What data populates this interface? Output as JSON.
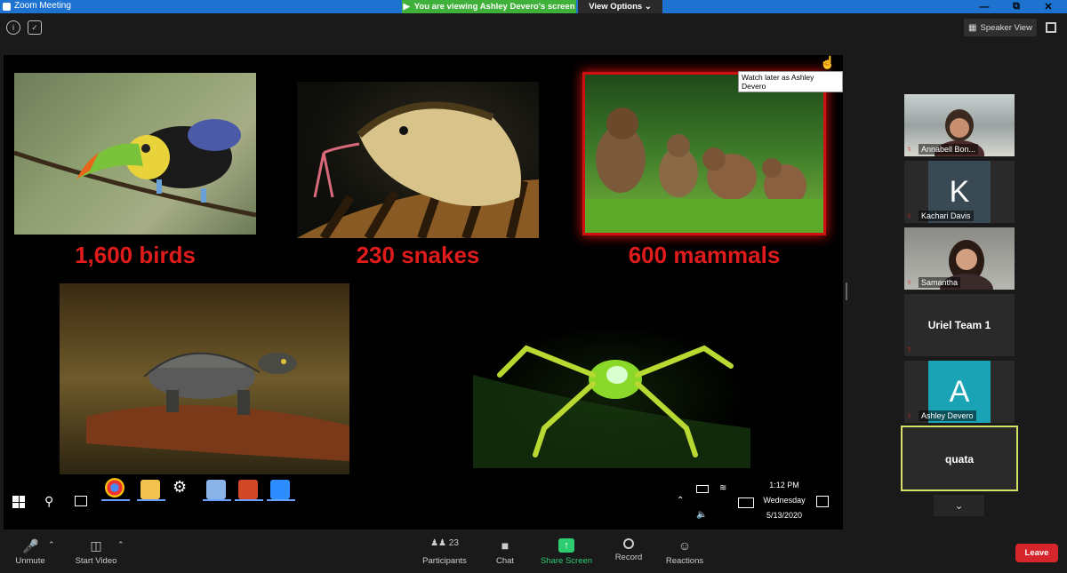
{
  "window": {
    "title": "Zoom Meeting",
    "viewing_banner": "You are viewing Ashley Devero's screen",
    "view_options": "View Options ⌄",
    "controls": [
      "—",
      "⧉",
      "✕"
    ]
  },
  "header": {
    "speaker_view_label": "Speaker View"
  },
  "share": {
    "tooltip": "Watch later as Ashley Devero",
    "captions": [
      "1,600 birds",
      "230 snakes",
      "600 mammals"
    ],
    "taskbar": {
      "time": "1:12 PM",
      "day": "Wednesday",
      "date": "5/13/2020"
    }
  },
  "participants_panel": {
    "tiles": [
      {
        "name": "Annabell Bon...",
        "type": "video"
      },
      {
        "name": "Kachari Davis",
        "type": "initial",
        "initial": "K",
        "color": "#3a4a55"
      },
      {
        "name": "Samantha",
        "type": "video"
      },
      {
        "name": "Uriel Team 1",
        "type": "text"
      },
      {
        "name": "Ashley Devero",
        "type": "initial",
        "initial": "A",
        "color": "#1aa3b4"
      },
      {
        "name": "quata",
        "type": "text",
        "highlighted": true
      }
    ]
  },
  "toolbar": {
    "unmute": "Unmute",
    "start_video": "Start Video",
    "participants": "Participants",
    "participants_count": "23",
    "chat": "Chat",
    "share_screen": "Share Screen",
    "record": "Record",
    "reactions": "Reactions",
    "leave": "Leave"
  },
  "colors": {
    "titlebar": "#1e73d0",
    "share_green": "#2ecc71",
    "leave_red": "#d7262b",
    "caption_red": "#e01b1b"
  }
}
